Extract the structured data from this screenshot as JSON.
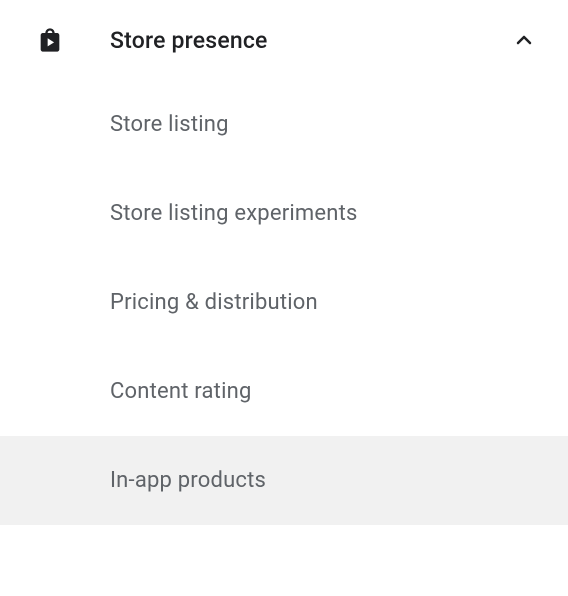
{
  "section": {
    "title": "Store presence",
    "expanded": true,
    "items": [
      {
        "label": "Store listing",
        "selected": false
      },
      {
        "label": "Store listing experiments",
        "selected": false
      },
      {
        "label": "Pricing & distribution",
        "selected": false
      },
      {
        "label": "Content rating",
        "selected": false
      },
      {
        "label": "In-app products",
        "selected": true
      }
    ]
  }
}
